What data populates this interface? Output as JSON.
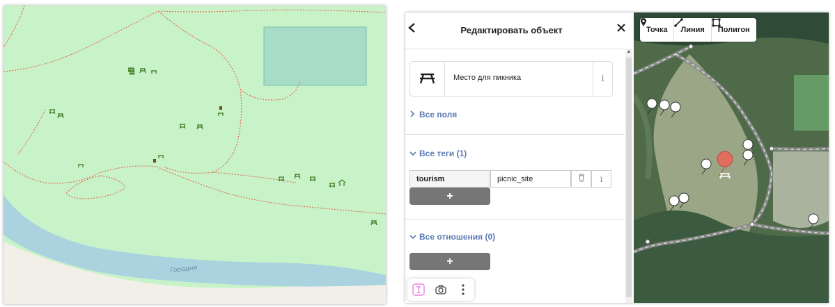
{
  "left_map": {
    "river_label": "Городня",
    "colors": {
      "land": "#c8f3c8",
      "water": "#aad3df",
      "sand": "#f2efe9",
      "path": "#e26f5a",
      "picnic": "#3a7a1c"
    }
  },
  "editor": {
    "header": {
      "title": "Редактировать объект",
      "back_icon": "chevron-left-icon",
      "close_icon": "close-icon"
    },
    "preset": {
      "name": "Место для пикника",
      "icon": "picnic-table-icon",
      "info": "i"
    },
    "sections": {
      "all_fields": "Все поля",
      "all_tags": "Все теги (1)",
      "all_relations": "Все отношения (0)"
    },
    "tags": [
      {
        "key": "tourism",
        "value": "picnic_site"
      }
    ],
    "tag_info": "i",
    "add_label": "+",
    "bottom_tools": [
      "text-cursor-icon",
      "camera-icon",
      "more-vertical-icon"
    ]
  },
  "mode_bar": {
    "point": "Точка",
    "line": "Линия",
    "area": "Полигон"
  },
  "accent_color": "#5b7ab3"
}
